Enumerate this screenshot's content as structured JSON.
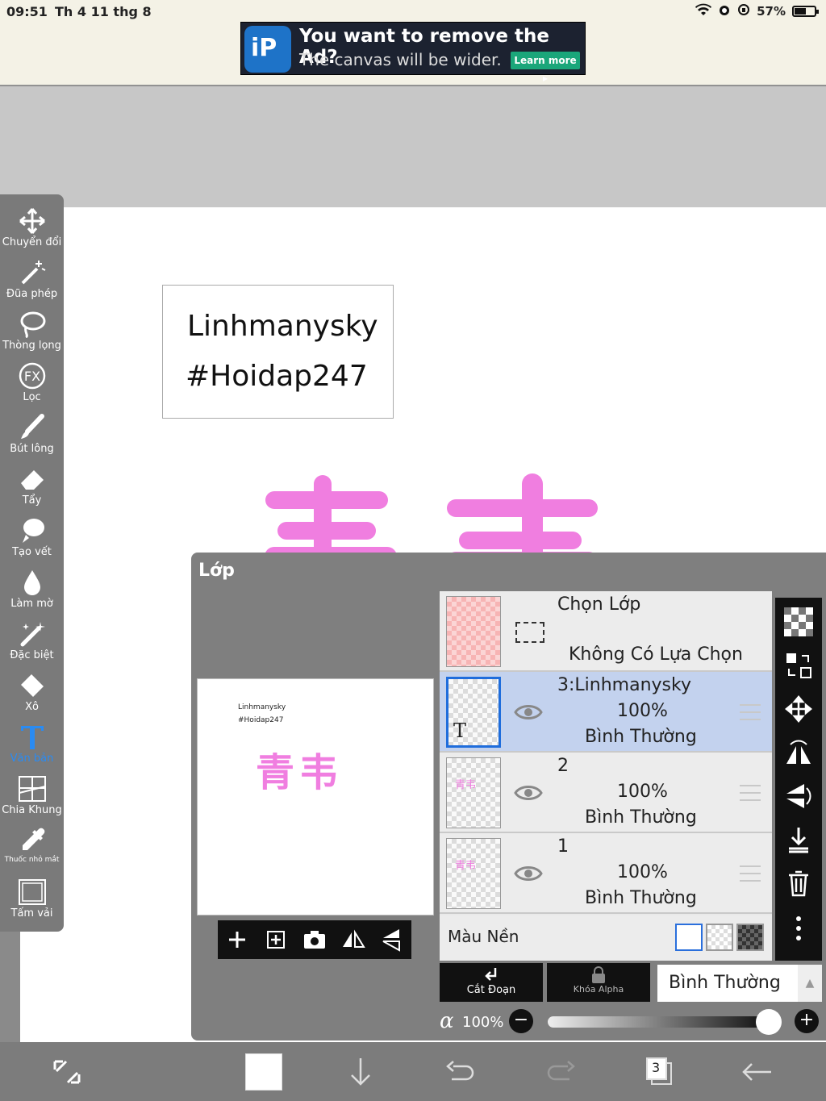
{
  "status": {
    "time": "09:51",
    "date": "Th 4 11 thg 8",
    "battery": "57%"
  },
  "ad": {
    "logo": "iP",
    "title": "You want to remove the Ad?",
    "subtitle": "The canvas will be wider.",
    "cta": "Learn more ▸"
  },
  "canvas": {
    "line1": "Linhmanysky",
    "line2": "#Hoidap247",
    "kanji": "青韦"
  },
  "toolbar": {
    "items": [
      {
        "label": "Chuyển đổi",
        "icon": "move-icon"
      },
      {
        "label": "Đũa phép",
        "icon": "magic-wand-icon"
      },
      {
        "label": "Thòng lọng",
        "icon": "lasso-icon"
      },
      {
        "label": "Lọc",
        "icon": "fx-icon"
      },
      {
        "label": "Bút lông",
        "icon": "brush-icon"
      },
      {
        "label": "Tẩy",
        "icon": "eraser-icon"
      },
      {
        "label": "Tạo vết",
        "icon": "smudge-icon"
      },
      {
        "label": "Làm mờ",
        "icon": "blur-icon"
      },
      {
        "label": "Đặc biệt",
        "icon": "special-icon"
      },
      {
        "label": "Xô",
        "icon": "bucket-icon"
      },
      {
        "label": "Văn bản",
        "icon": "text-icon"
      },
      {
        "label": "Chia Khung",
        "icon": "frame-divider-icon"
      },
      {
        "label": "Thuốc nhỏ mắt",
        "icon": "eyedropper-icon"
      },
      {
        "label": "Tấm vải",
        "icon": "canvas-icon"
      }
    ],
    "selected_index": 10,
    "selected_color": "#2a8bf2"
  },
  "panel": {
    "title": "Lớp",
    "preview": {
      "line1": "Linhmanysky",
      "line2": "#Hoidap247",
      "kanji": "青韦"
    },
    "selection": {
      "title": "Chọn Lớp",
      "status": "Không Có Lựa Chọn"
    },
    "layers": [
      {
        "name": "3:Linhmanysky",
        "opacity": "100%",
        "mode": "Bình Thường",
        "thumb_glyph": "T"
      },
      {
        "name": "2",
        "opacity": "100%",
        "mode": "Bình Thường",
        "thumb_glyph": "青韦"
      },
      {
        "name": "1",
        "opacity": "100%",
        "mode": "Bình Thường",
        "thumb_glyph": "青韦"
      }
    ],
    "background_label": "Màu Nền",
    "cut_label": "Cắt Đoạn",
    "alpha_lock_label": "Khóa Alpha",
    "blend_mode": "Bình Thường",
    "alpha_symbol": "α",
    "opacity_value": "100%",
    "opacity_fraction": 1.0,
    "minus": "−",
    "plus": "+"
  },
  "bottom": {
    "layer_count": "3"
  },
  "colors": {
    "accent": "#2a8bf2",
    "kanji_pink": "#f07ee0",
    "kanji_dark": "#7a3d7c"
  }
}
